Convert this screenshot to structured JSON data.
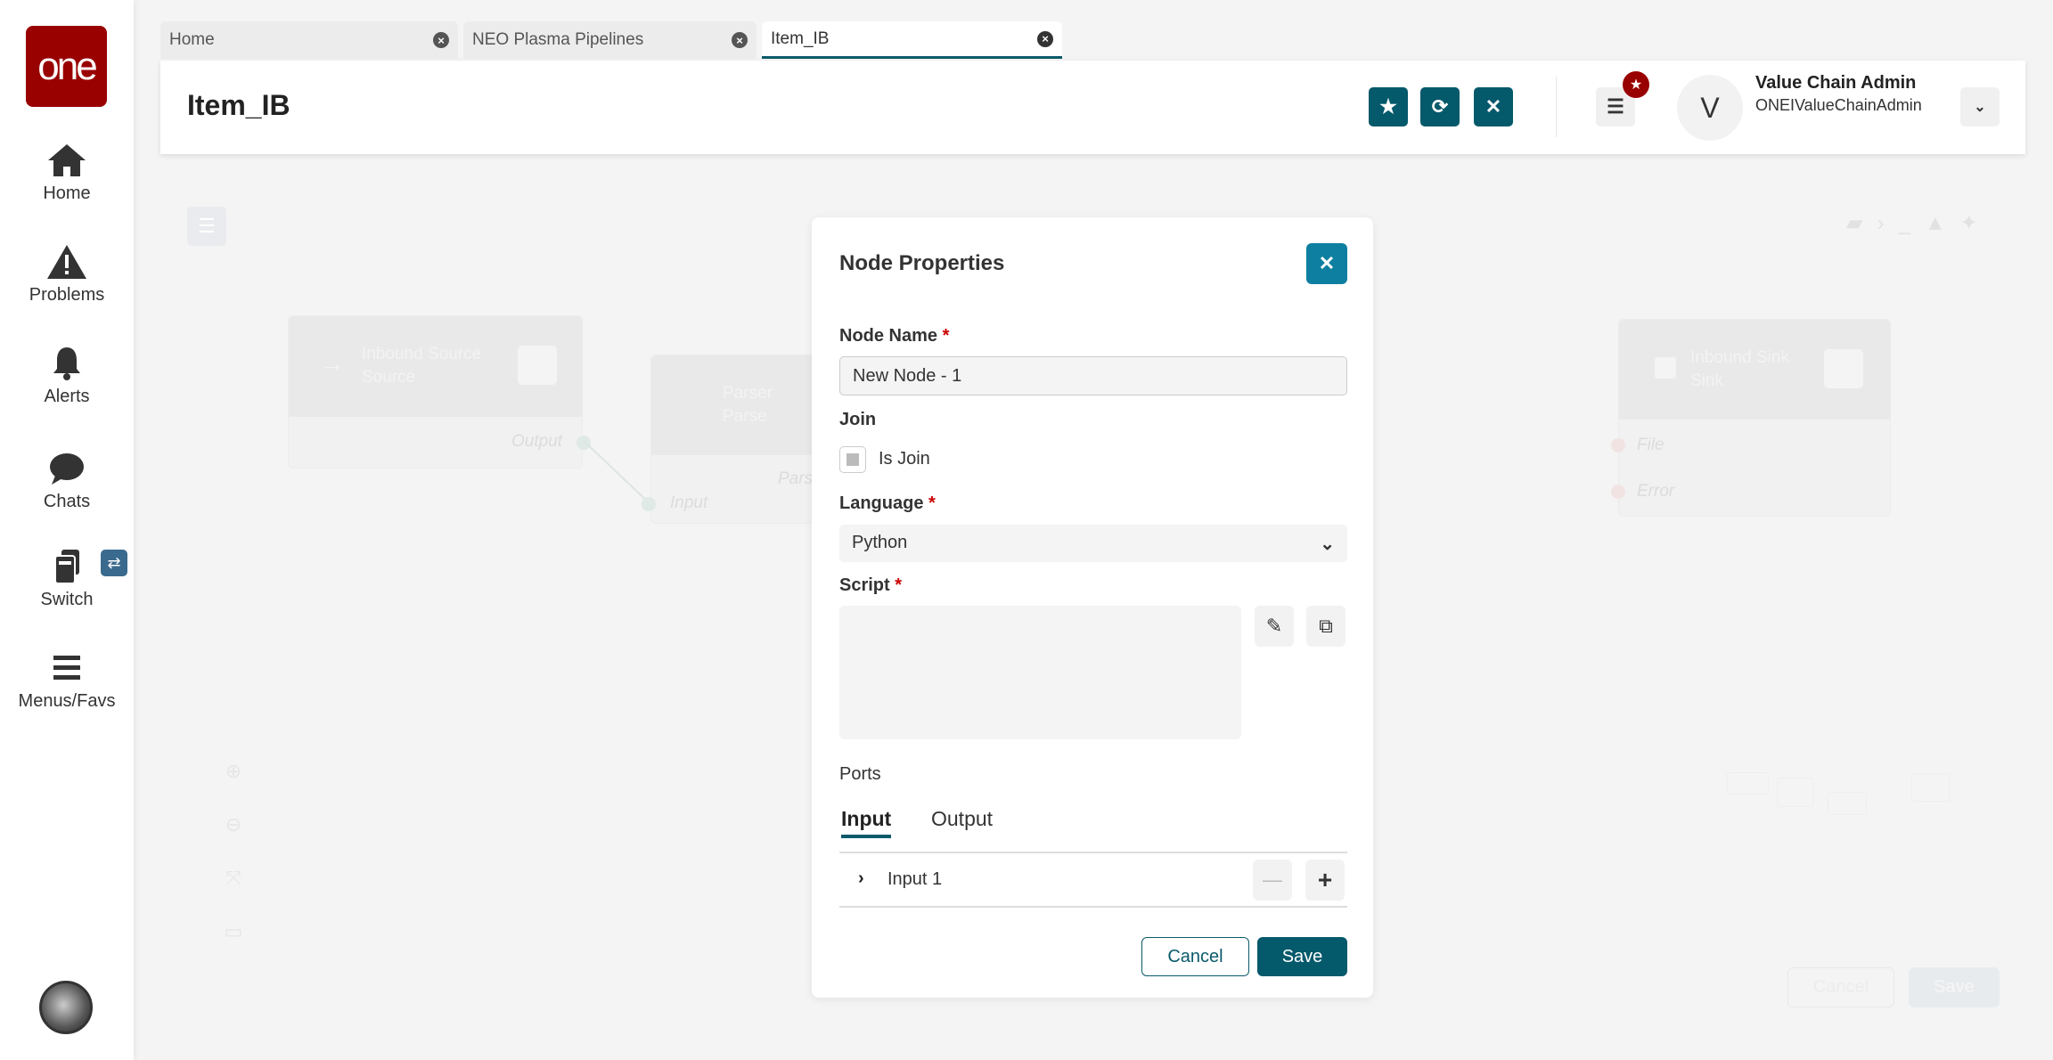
{
  "sidebar": {
    "logo": "one",
    "items": [
      {
        "label": "Home",
        "icon": "home-icon"
      },
      {
        "label": "Problems",
        "icon": "warning-icon"
      },
      {
        "label": "Alerts",
        "icon": "bell-icon"
      },
      {
        "label": "Chats",
        "icon": "chat-icon"
      },
      {
        "label": "Switch",
        "icon": "switch-icon"
      },
      {
        "label": "Menus/Favs",
        "icon": "menu-icon"
      }
    ],
    "switch_badge": "⇄"
  },
  "tabs": [
    {
      "label": "Home",
      "active": false
    },
    {
      "label": "NEO Plasma Pipelines",
      "active": false
    },
    {
      "label": "Item_IB",
      "active": true
    }
  ],
  "header": {
    "title": "Item_IB",
    "user_initial": "V",
    "user_name": "Value Chain Admin",
    "user_id": "ONEIValueChainAdmin"
  },
  "canvas": {
    "nodes": [
      {
        "title": "Inbound Source",
        "subtitle": "Source",
        "port": "Output"
      },
      {
        "title": "Parser",
        "subtitle": "Parse",
        "port": "Input",
        "port2": "Parse"
      },
      {
        "title": "Inbound Sink",
        "subtitle": "Sink",
        "ports": [
          "File",
          "Error"
        ]
      }
    ],
    "cancel": "Cancel",
    "save": "Save"
  },
  "modal": {
    "title": "Node Properties",
    "node_name_label": "Node Name",
    "node_name_value": "New Node - 1",
    "join_label": "Join",
    "is_join_label": "Is Join",
    "is_join_checked": false,
    "language_label": "Language",
    "language_value": "Python",
    "script_label": "Script",
    "script_value": "",
    "ports_label": "Ports",
    "port_tabs": [
      "Input",
      "Output"
    ],
    "active_port_tab": "Input",
    "ports": [
      {
        "label": "Input 1"
      }
    ],
    "required_mark": "*",
    "cancel": "Cancel",
    "save": "Save"
  },
  "colors": {
    "brand": "#990000",
    "primary": "#04596b",
    "close_button": "#0e7fa0"
  }
}
